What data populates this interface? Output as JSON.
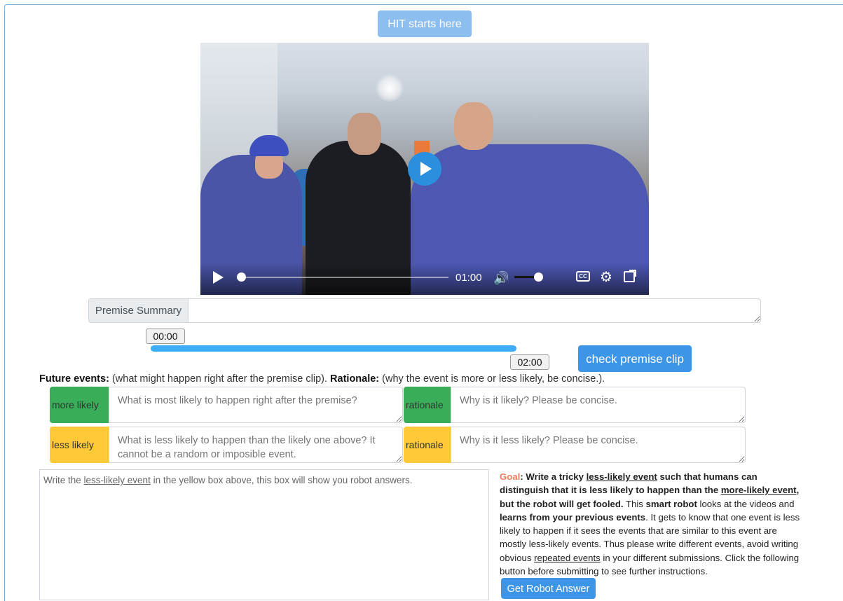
{
  "header": {
    "hit_label": "HIT starts here"
  },
  "video": {
    "current_time": "01:00",
    "position_fraction": 0.0,
    "volume_fraction": 0.8
  },
  "premise": {
    "label": "Premise Summary",
    "value": ""
  },
  "clip": {
    "start": "00:00",
    "end": "02:00",
    "check_label": "check premise clip"
  },
  "instructions": {
    "future_label": "Future events:",
    "future_text": " (what might happen right after the premise clip). ",
    "rationale_label": "Rationale:",
    "rationale_text": " (why the event is more or less likely, be concise.)."
  },
  "events": [
    {
      "tag": "more likely",
      "placeholder": "What is most likely to happen right after the premise?",
      "rationale_tag": "rationale",
      "rationale_placeholder": "Why is it likely? Please be concise.",
      "color": "#3aad58"
    },
    {
      "tag": "less likely",
      "placeholder": "What is less likely to happen than the likely one above? It cannot be a random or imposible event.",
      "rationale_tag": "rationale",
      "rationale_placeholder": "Why is it less likely? Please be concise.",
      "color": "#fdc937"
    }
  ],
  "robot": {
    "box_pre": "Write the ",
    "box_link": "less-likely event",
    "box_post": " in the yellow box above, this box will show you robot answers.",
    "button_label": "Get Robot Answer"
  },
  "goal": {
    "word": "Goal",
    "p1": ": Write a tricky ",
    "u1": "less-likely event",
    "p2": " such that humans can distinguish that it is less likely to happen than the ",
    "u2": "more-likely event",
    "p3": ", but the robot will get fooled.",
    "p4": " This ",
    "b1": "smart robot",
    "p5": " looks at the videos and ",
    "b2": "learns from your previous events",
    "p6": ". It gets to know that one event is less likely to happen if it sees the events that are similar to this event are mostly less-likely events. Thus please write different events, avoid writing obvious ",
    "u3": "repeated events",
    "p7": " in your different submissions. Click the following button before submitting to see further instructions."
  }
}
